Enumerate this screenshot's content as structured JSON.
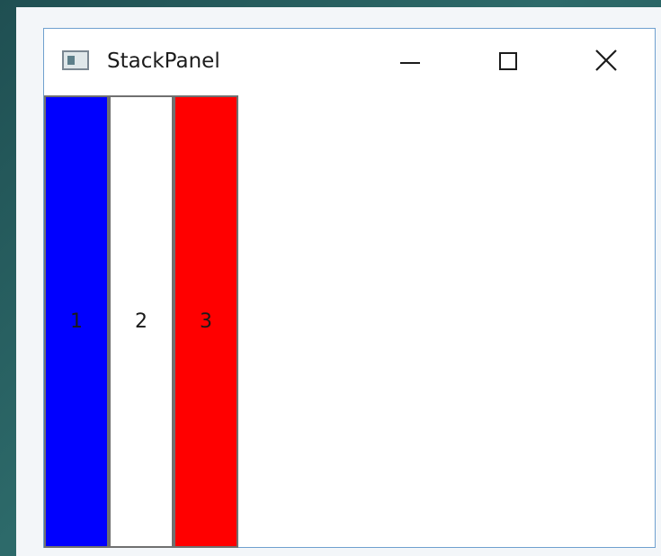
{
  "window": {
    "title": "StackPanel",
    "icon": "window-app-icon",
    "controls": {
      "minimize_icon": "minimize-icon",
      "maximize_icon": "maximize-icon",
      "close_icon": "close-icon"
    }
  },
  "stack_panel": {
    "buttons": [
      {
        "label": "1",
        "background": "#0000ff"
      },
      {
        "label": "2",
        "background": "#ffffff"
      },
      {
        "label": "3",
        "background": "#ff0000"
      }
    ]
  },
  "colors": {
    "window_border": "#6fa0cf",
    "desktop": "#2d6a6a"
  }
}
